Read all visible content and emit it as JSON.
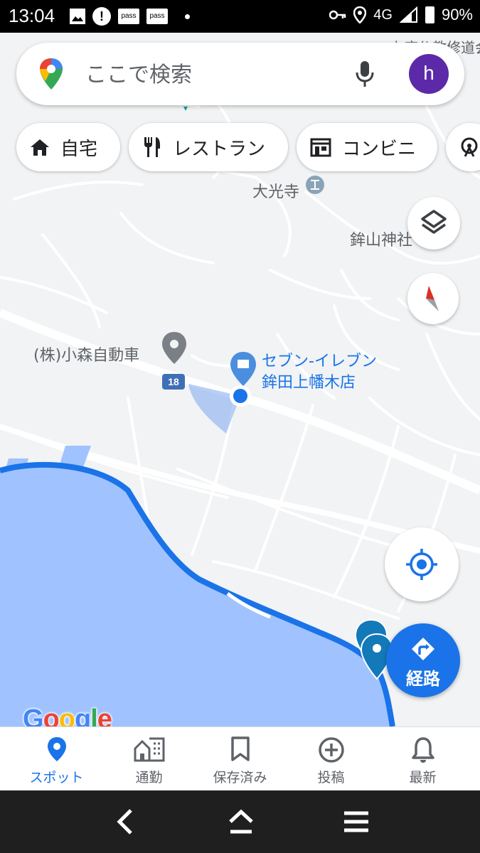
{
  "status_bar": {
    "time": "13:04",
    "pass_labels": [
      "pass",
      "pass"
    ],
    "network": "4G",
    "battery": "90%",
    "alert_icon": "exclamation-icon"
  },
  "search": {
    "placeholder": "ここで検索",
    "avatar_letter": "h"
  },
  "chips": [
    {
      "label": "自宅",
      "icon": "home-icon"
    },
    {
      "label": "レストラン",
      "icon": "restaurant-icon"
    },
    {
      "label": "コンビニ",
      "icon": "store-icon"
    }
  ],
  "map": {
    "labels": {
      "temple": "大光寺",
      "shrine": "鉾山神社",
      "top_partial": "上座仏教修道会",
      "company": "(株)小森自動車",
      "store_line1": "セブン-イレブン",
      "store_line2": "鉾田上幡木店"
    },
    "route_number": "18",
    "logo": {
      "G": "G",
      "o1": "o",
      "o2": "o",
      "g": "g",
      "l": "l",
      "e": "e"
    }
  },
  "route_button": {
    "label": "経路"
  },
  "bottom_nav": [
    {
      "label": "スポット",
      "icon": "pin-icon",
      "active": true
    },
    {
      "label": "通勤",
      "icon": "commute-icon",
      "active": false
    },
    {
      "label": "保存済み",
      "icon": "bookmark-icon",
      "active": false
    },
    {
      "label": "投稿",
      "icon": "add-circle-icon",
      "active": false
    },
    {
      "label": "最新",
      "icon": "bell-icon",
      "active": false
    }
  ],
  "colors": {
    "accent": "#1a73e8",
    "water": "#a0c3ff",
    "avatar": "#5c2aa8",
    "route_badge": "#3f6fb7"
  }
}
